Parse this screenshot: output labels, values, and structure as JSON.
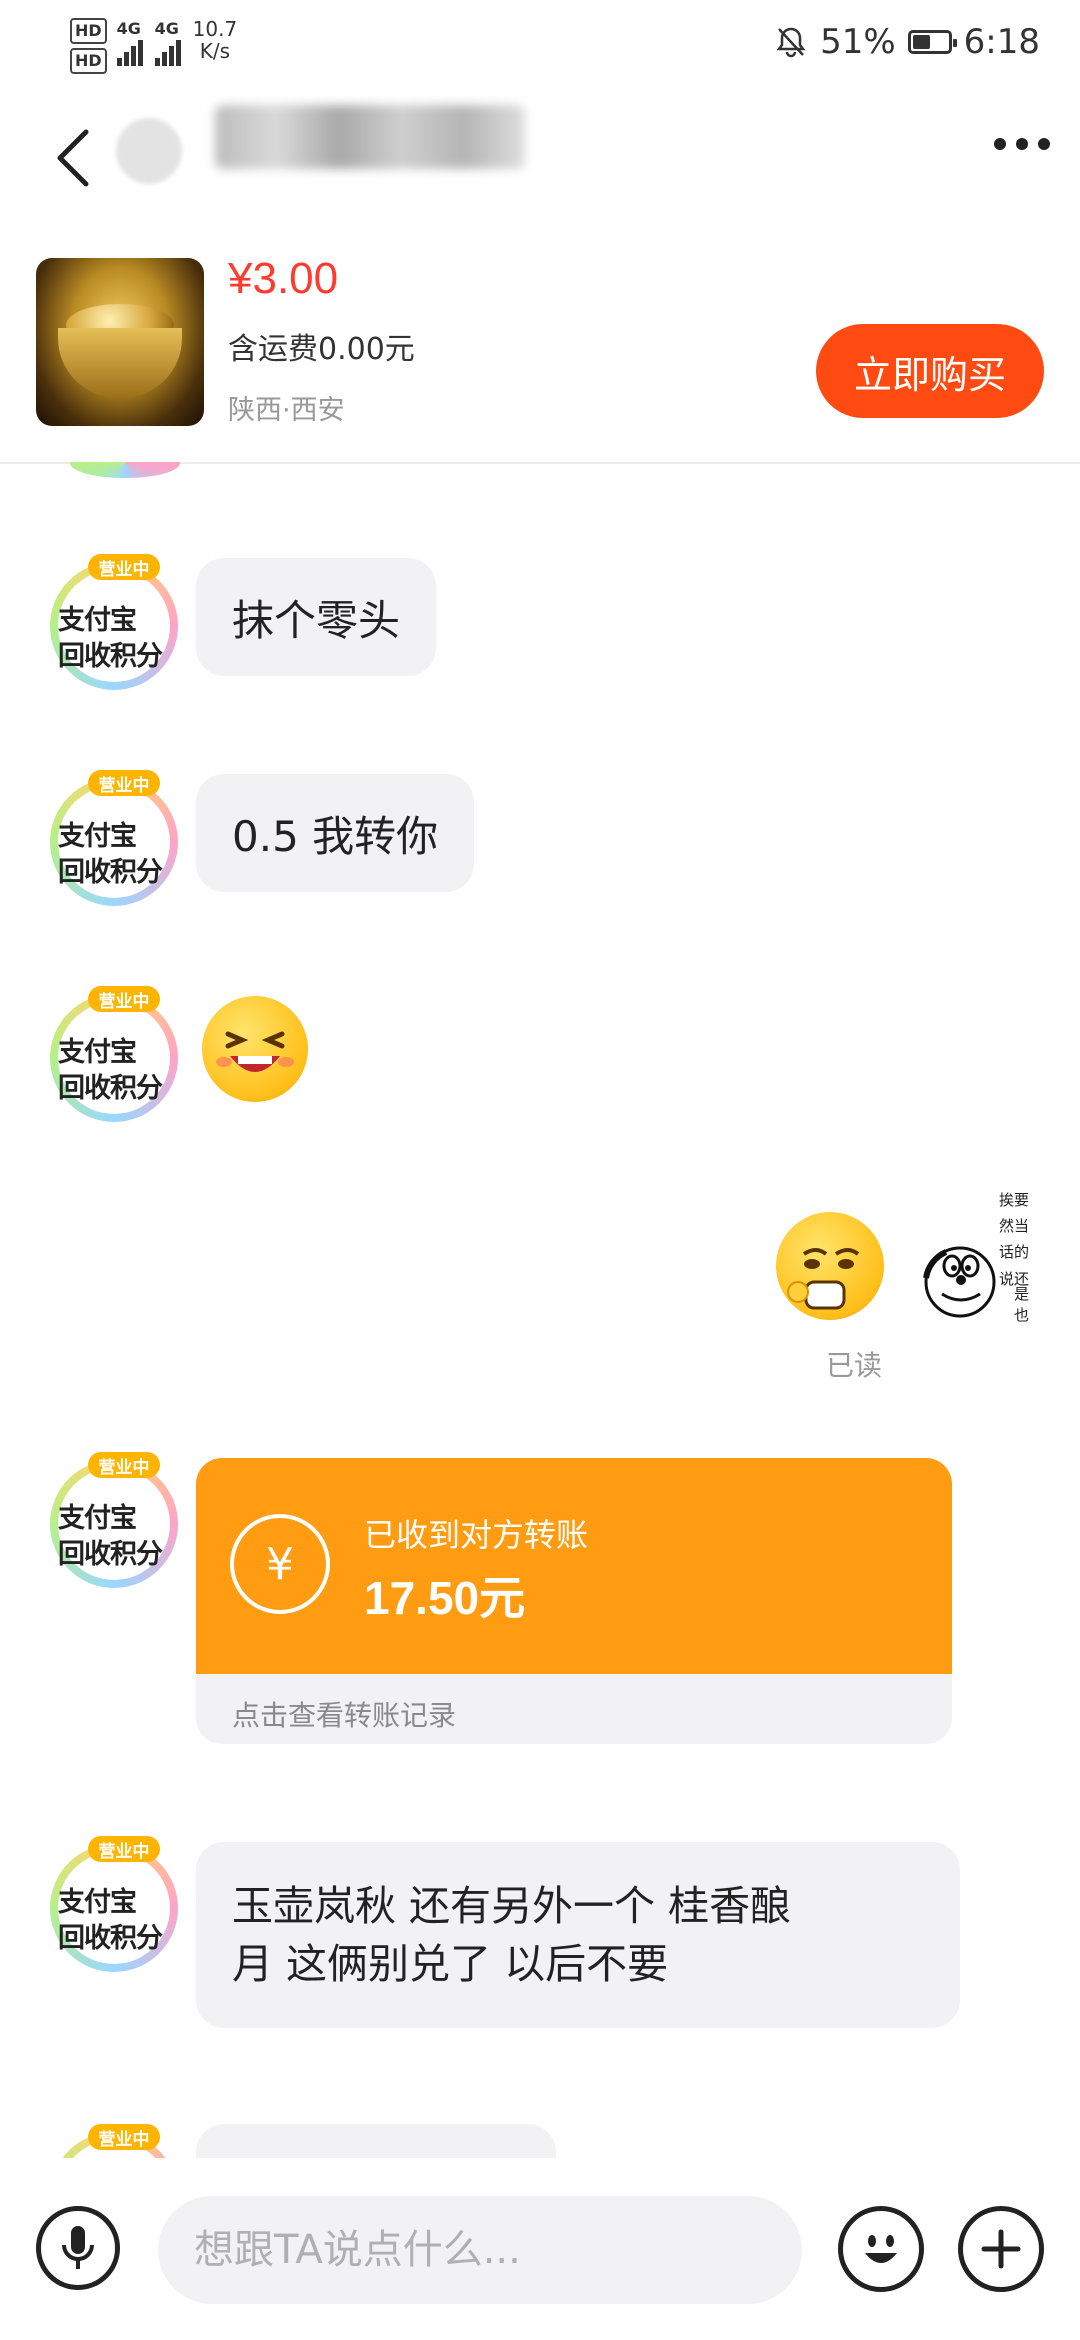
{
  "status_bar": {
    "hd1": "HD",
    "hd2": "HD",
    "net_type1": "4G",
    "net_type2": "4G",
    "speed_value": "10.7",
    "speed_unit": "K/s",
    "battery_percent": "51%",
    "battery_level": 0.51,
    "time": "6:18"
  },
  "product": {
    "price": "¥3.00",
    "shipping": "含运费0.00元",
    "location": "陕西·西安",
    "buy_label": "立即购买"
  },
  "messages": {
    "m1": "抹个零头",
    "m2": "0.5  我转你",
    "read_status": "已读",
    "transfer_title": "已收到对方转账",
    "transfer_amount": "17.50元",
    "transfer_link": "点击查看转账记录",
    "m3_line1": "玉壶岚秋  还有另外一个 桂香酿",
    "m3_line2": "月  这俩别兑了  以后不要"
  },
  "avatar": {
    "badge": "营业中",
    "line1": "支付宝",
    "line2": "回收积分"
  },
  "sticker_text": {
    "col1": "要挨",
    "col2": "当然",
    "col3": "的话",
    "col4": "还是说",
    "col5": "也"
  },
  "input": {
    "placeholder": "想跟TA说点什么..."
  },
  "colors": {
    "accent": "#ff4b12",
    "price": "#ff3b30",
    "transfer": "#ff9c12"
  }
}
